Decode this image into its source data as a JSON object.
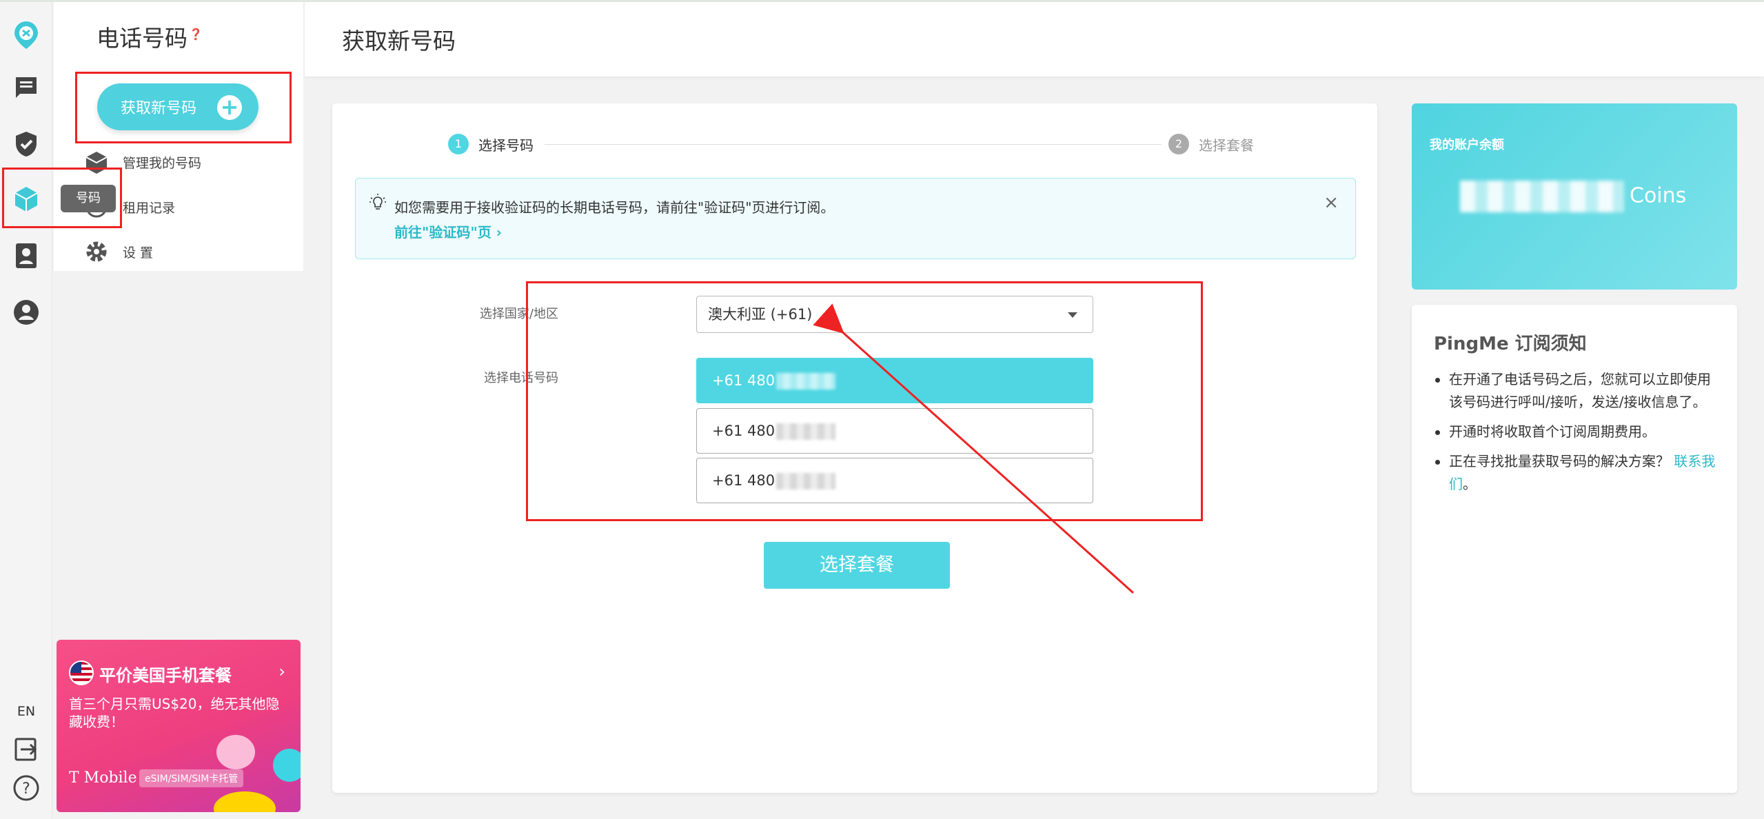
{
  "sidebar": {
    "title": "电话号码",
    "get_button_label": "获取新号码",
    "items": [
      {
        "label": "管理我的号码"
      },
      {
        "label": "租用记录"
      },
      {
        "label": "设 置"
      }
    ],
    "tooltip": "号码",
    "lang": "EN"
  },
  "promo": {
    "title": "平价美国手机套餐",
    "desc": "首三个月只需US$20，绝无其他隐藏收费！",
    "brand": "T Mobile",
    "tag": "eSIM/SIM/SIM卡托管"
  },
  "header": {
    "title": "获取新号码"
  },
  "steps": [
    {
      "num": "1",
      "label": "选择号码",
      "active": true
    },
    {
      "num": "2",
      "label": "选择套餐",
      "active": false
    }
  ],
  "notice": {
    "text": "如您需要用于接收验证码的长期电话号码，请前往\"验证码\"页进行订阅。",
    "link": "前往\"验证码\"页"
  },
  "form": {
    "country_label": "选择国家/地区",
    "country_value": "澳大利亚 (+61)",
    "number_label": "选择电话号码",
    "numbers": [
      {
        "prefix": "+61 480",
        "selected": true
      },
      {
        "prefix": "+61 480",
        "selected": false
      },
      {
        "prefix": "+61 480",
        "selected": false
      }
    ],
    "submit_label": "选择套餐"
  },
  "balance": {
    "title": "我的账户余额",
    "unit": "Coins"
  },
  "rules": {
    "title": "PingMe 订阅须知",
    "items": [
      "在开通了电话号码之后，您就可以立即使用该号码进行呼叫/接听，发送/接收信息了。",
      "开通时将收取首个订阅周期费用。",
      "正在寻找批量获取号码的解决方案？"
    ],
    "contact_link": "联系我们"
  },
  "colors": {
    "accent": "#4fd6e2",
    "link": "#2cb9c8",
    "annotation": "#ee2222",
    "promo": "#f64f86"
  }
}
